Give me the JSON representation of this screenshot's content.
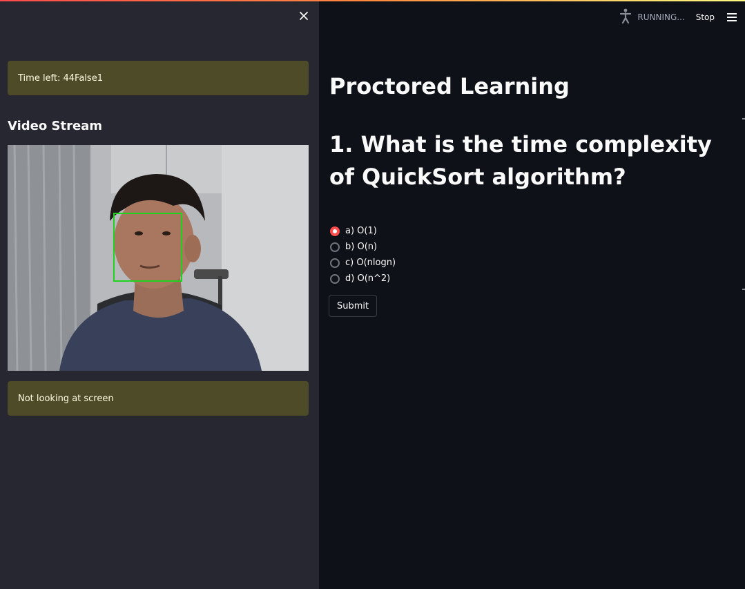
{
  "sidebar": {
    "close_icon": "close-icon",
    "timer_text": "Time left: 44False1",
    "video_title": "Video Stream",
    "status_text": "Not looking at screen",
    "alert_color": "#4e4b28",
    "face_box_color": "#1ed41e"
  },
  "header": {
    "running_icon": "running-person-icon",
    "running_label": "RUNNING...",
    "stop_label": "Stop",
    "menu_icon": "hamburger-menu-icon"
  },
  "main": {
    "title": "Proctored Learning",
    "question": "1. What is the time complexity of QuickSort algorithm?",
    "options": [
      {
        "label": "a) O(1)",
        "selected": true
      },
      {
        "label": "b) O(n)",
        "selected": false
      },
      {
        "label": "c) O(nlogn)",
        "selected": false
      },
      {
        "label": "d) O(n^2)",
        "selected": false
      }
    ],
    "submit_label": "Submit",
    "accent_color": "#ff4b4b"
  }
}
